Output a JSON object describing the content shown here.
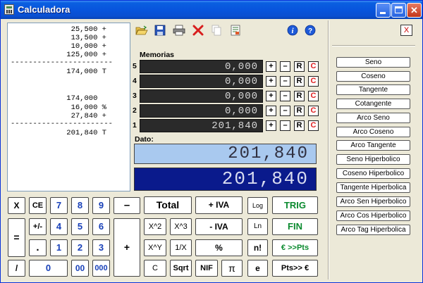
{
  "window": {
    "title": "Calculadora"
  },
  "tape": [
    "25,500 +",
    "13,500 +",
    "10,000 +",
    "125,000 +",
    "-----------------------",
    "174,000 T",
    "",
    "",
    "174,000  ",
    "16,000 %",
    "27,840 +",
    "-----------------------",
    "201,840 T"
  ],
  "memorias": {
    "label": "Memorias",
    "rows": [
      {
        "num": "5",
        "value": "0,000"
      },
      {
        "num": "4",
        "value": "0,000"
      },
      {
        "num": "3",
        "value": "0,000"
      },
      {
        "num": "2",
        "value": "0,000"
      },
      {
        "num": "1",
        "value": "201,840"
      }
    ],
    "btn_plus": "+",
    "btn_minus": "–",
    "btn_r": "R",
    "btn_c": "C"
  },
  "dato": {
    "label": "Dato:",
    "value": "201,840"
  },
  "result": {
    "value": "201,840"
  },
  "close_panel": "X",
  "keys": {
    "x": "X",
    "ce": "CE",
    "n7": "7",
    "n8": "8",
    "n9": "9",
    "minus": "–",
    "total": "Total",
    "plus_iva": "+ IVA",
    "log": "Log",
    "trig": "TRIG",
    "eq": "=",
    "pm": "+/-",
    "n4": "4",
    "n5": "5",
    "n6": "6",
    "plus": "+",
    "x2": "X^2",
    "x3": "X^3",
    "minus_iva": "- IVA",
    "ln": "Ln",
    "fin": "FIN",
    "dot": ".",
    "n1": "1",
    "n2": "2",
    "n3": "3",
    "xy": "X^Y",
    "inv": "1/X",
    "pct": "%",
    "fact": "n!",
    "eur_pts": "€ >>Pts",
    "div": "/",
    "n0": "0",
    "n00": "00",
    "n000": "000",
    "c": "C",
    "sqrt": "Sqrt",
    "nif": "NIF",
    "pi": "π",
    "e": "e",
    "pts_eur": "Pts>> €"
  },
  "functions": [
    "Seno",
    "Coseno",
    "Tangente",
    "Cotangente",
    "Arco Seno",
    "Arco Coseno",
    "Arco Tangente",
    "Seno Hiperbolico",
    "Coseno Hiperbolico",
    "Tangente Hiperbolica",
    "Arco Sen Hiperbolico",
    "Arco Cos Hiperbolico",
    "Arco Tag Hiperbolica"
  ],
  "colors": {
    "title_blue": "#0855DD",
    "dato_bg": "#A9C9EF",
    "result_bg": "#0A1A8C",
    "key_blue": "#1840B8",
    "key_green": "#0A8A2E",
    "mem_red": "#E02020"
  },
  "icons": [
    "open-folder-icon",
    "save-icon",
    "print-icon",
    "delete-icon",
    "copy-icon",
    "notes-icon",
    "info-icon",
    "help-icon"
  ]
}
